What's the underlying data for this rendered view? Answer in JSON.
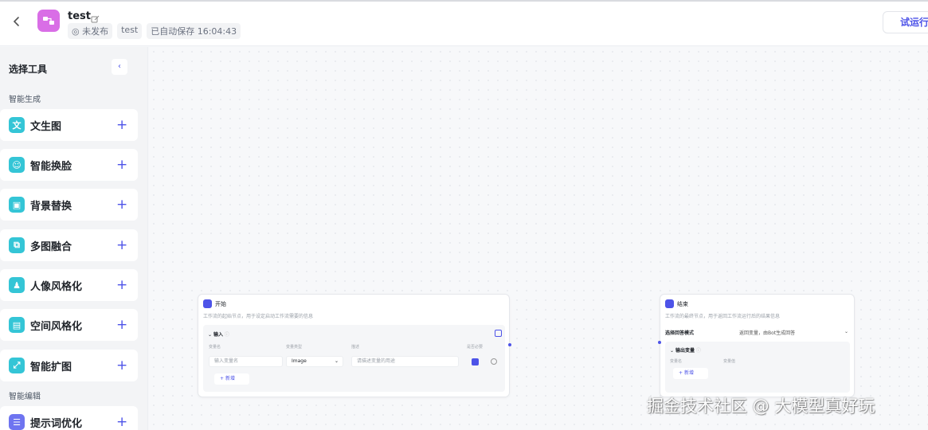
{
  "header": {
    "app_name": "test",
    "status": "未发布",
    "tag": "test",
    "autosave": "已自动保存 16:04:43",
    "run_label": "试运行"
  },
  "sidebar": {
    "title": "选择工具",
    "sections": [
      {
        "label": "智能生成"
      },
      {
        "label": "智能编辑"
      }
    ],
    "tools": [
      {
        "label": "文生图",
        "icon": "text-to-image-icon",
        "glyph": "文"
      },
      {
        "label": "智能换脸",
        "icon": "face-swap-icon",
        "glyph": "☺"
      },
      {
        "label": "背景替换",
        "icon": "background-replace-icon",
        "glyph": "▣"
      },
      {
        "label": "多图融合",
        "icon": "multi-image-fusion-icon",
        "glyph": "⧉"
      },
      {
        "label": "人像风格化",
        "icon": "portrait-style-icon",
        "glyph": "♟"
      },
      {
        "label": "空间风格化",
        "icon": "space-style-icon",
        "glyph": "▤"
      },
      {
        "label": "智能扩图",
        "icon": "image-expand-icon",
        "glyph": "⤢"
      },
      {
        "label": "提示词优化",
        "icon": "prompt-optimize-icon",
        "glyph": "☰"
      }
    ]
  },
  "start_node": {
    "title": "开始",
    "desc": "工作流的起始节点，用于设定启动工作流需要的信息",
    "section": "输入",
    "col_name": "变量名",
    "col_type": "变量类型",
    "col_desc": "描述",
    "col_required": "是否必要",
    "name_placeholder": "输入变量名",
    "type_value": "Image",
    "desc_placeholder": "请描述变量的用途",
    "add_label": "新增"
  },
  "end_node": {
    "title": "结束",
    "desc": "工作流的最终节点，用于返回工作流运行后的结果信息",
    "mode_label": "选择回答模式",
    "mode_value": "返回变量，由Bot生成回答",
    "section": "输出变量",
    "col_name": "变量名",
    "col_value": "变量值",
    "add_label": "新增"
  },
  "watermark": "掘金技术社区 @ 大模型真好玩",
  "colors": {
    "accent": "#4d53e8",
    "tool_icon": "#34c5d6",
    "app_icon": "#d96ee6"
  }
}
